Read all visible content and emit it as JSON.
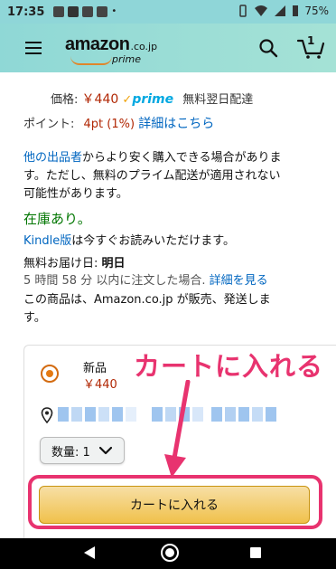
{
  "status_bar": {
    "time": "17:35",
    "battery": "75%"
  },
  "header": {
    "logo_text": "amazon",
    "logo_domain": ".co.jp",
    "logo_prime": "prime",
    "cart_count": "1"
  },
  "price_block": {
    "price_label": "価格:",
    "price_value": "￥440",
    "prime_label": "prime",
    "shipping": "無料翌日配達",
    "points_label": "ポイント:",
    "points_value": "4pt",
    "points_percent": "(1%)",
    "details_link": "詳細はこちら"
  },
  "other_sellers": {
    "link": "他の出品者",
    "line1": "からより安く購入できる場合がありま",
    "line2": "す。ただし、無料のプライム配送が適用されない",
    "line3": "可能性があります。"
  },
  "stock": {
    "in_stock": "在庫あり。",
    "kindle_link": "Kindle版",
    "kindle_text": "は今すぐお読みいただけます。"
  },
  "delivery": {
    "label": "無料お届け日: ",
    "date": "明日",
    "cutoff": "5 時間 58 分 以内に注文した場合.",
    "details_link": "詳細を見る",
    "sold_by_line1": "この商品は、Amazon.co.jp が販売、発送しま",
    "sold_by_line2": "す。"
  },
  "buy_box": {
    "condition": "新品",
    "price": "￥440",
    "quantity_label": "数量: 1",
    "add_to_cart": "カートに入れる"
  },
  "annotation": {
    "text": "カートに入れる",
    "color": "#e8336f"
  },
  "colors": {
    "header_bg": "#8fd8d6",
    "price": "#b12704",
    "link": "#0066c0",
    "stock": "#007600",
    "cart_button": "#f0c14b"
  }
}
